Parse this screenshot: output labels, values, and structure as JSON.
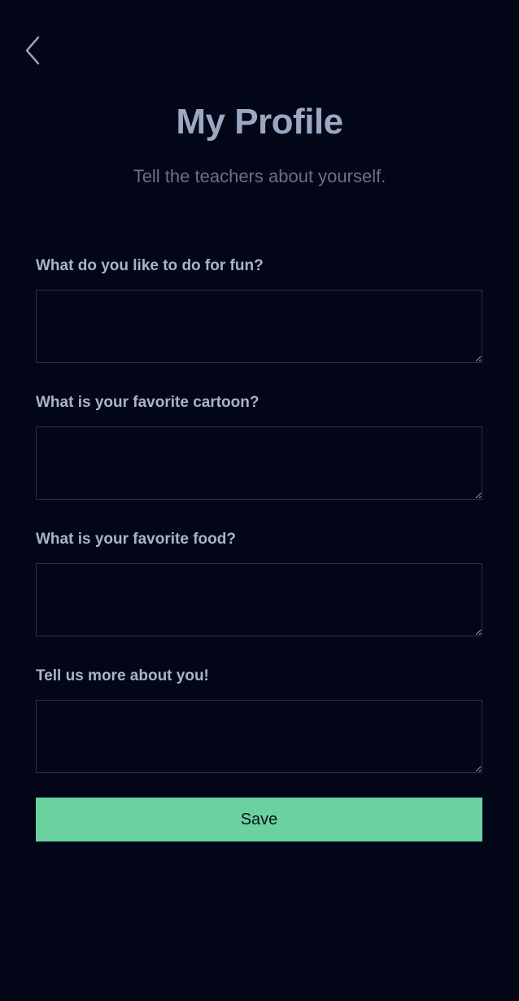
{
  "header": {
    "back_icon": "chevron-left-icon",
    "title": "My Profile",
    "subtitle": "Tell the teachers about yourself."
  },
  "form": {
    "fields": [
      {
        "label": "What do you like to do for fun?",
        "value": ""
      },
      {
        "label": "What is your favorite cartoon?",
        "value": ""
      },
      {
        "label": "What is your favorite food?",
        "value": ""
      },
      {
        "label": "Tell us more about you!",
        "value": ""
      }
    ],
    "save_label": "Save"
  },
  "colors": {
    "background": "#020617",
    "accent": "#6ad19f",
    "title": "#9aa8c1",
    "subtitle": "#6b7280",
    "label": "#a8b4c8",
    "input_border": "#273244"
  }
}
